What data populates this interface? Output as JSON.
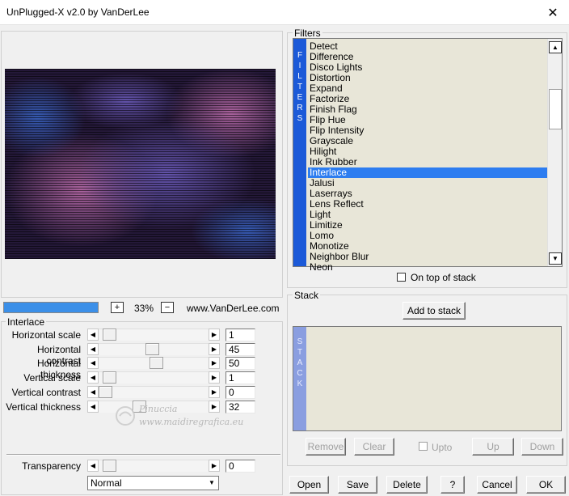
{
  "window": {
    "title": "UnPlugged-X v2.0 by VanDerLee",
    "close_glyph": "✕"
  },
  "zoom": {
    "plus": "+",
    "minus": "−",
    "level": "33%",
    "website": "www.VanDerLee.com"
  },
  "interlace": {
    "group_label": "Interlace",
    "params": [
      {
        "label": "Horizontal scale",
        "value": "1",
        "slider_fraction": 0.04
      },
      {
        "label": "Horizontal contrast",
        "value": "45",
        "slider_fraction": 0.49
      },
      {
        "label": "Horizontal thickness",
        "value": "50",
        "slider_fraction": 0.53
      },
      {
        "label": "Vertical scale",
        "value": "1",
        "slider_fraction": 0.04
      },
      {
        "label": "Vertical contrast",
        "value": "0",
        "slider_fraction": 0.0
      },
      {
        "label": "Vertical thickness",
        "value": "32",
        "slider_fraction": 0.35
      }
    ],
    "transparency": {
      "label": "Transparency",
      "value": "0",
      "slider_fraction": 0.04
    },
    "blend_mode": "Normal"
  },
  "watermark": {
    "line1": "Pinuccia",
    "line2": "www.maidiregrafica.eu"
  },
  "filters": {
    "group_label": "Filters",
    "strip_letters": [
      "F",
      "I",
      "L",
      "T",
      "E",
      "R",
      "S"
    ],
    "items": [
      "Detect",
      "Difference",
      "Disco Lights",
      "Distortion",
      "Expand",
      "Factorize",
      "Finish Flag",
      "Flip Hue",
      "Flip Intensity",
      "Grayscale",
      "Hilight",
      "Ink Rubber",
      "Interlace",
      "Jalusi",
      "Laserrays",
      "Lens Reflect",
      "Light",
      "Limitize",
      "Lomo",
      "Monotize",
      "Neighbor Blur",
      "Neon"
    ],
    "selected": "Interlace",
    "on_top_label": "On top of stack",
    "on_top_checked": false
  },
  "stack": {
    "group_label": "Stack",
    "add_button": "Add to stack",
    "strip_letters": [
      "S",
      "T",
      "A",
      "C",
      "K"
    ],
    "remove": "Remove",
    "clear": "Clear",
    "upto": "Upto",
    "up": "Up",
    "down": "Down"
  },
  "footer": {
    "open": "Open",
    "save": "Save",
    "delete": "Delete",
    "help": "?",
    "cancel": "Cancel",
    "ok": "OK"
  },
  "colors": {
    "selection": "#2d7df0",
    "strip": "#1c5ad8",
    "stack_strip": "#8a9ee0",
    "progress": "#3b8fe8"
  }
}
